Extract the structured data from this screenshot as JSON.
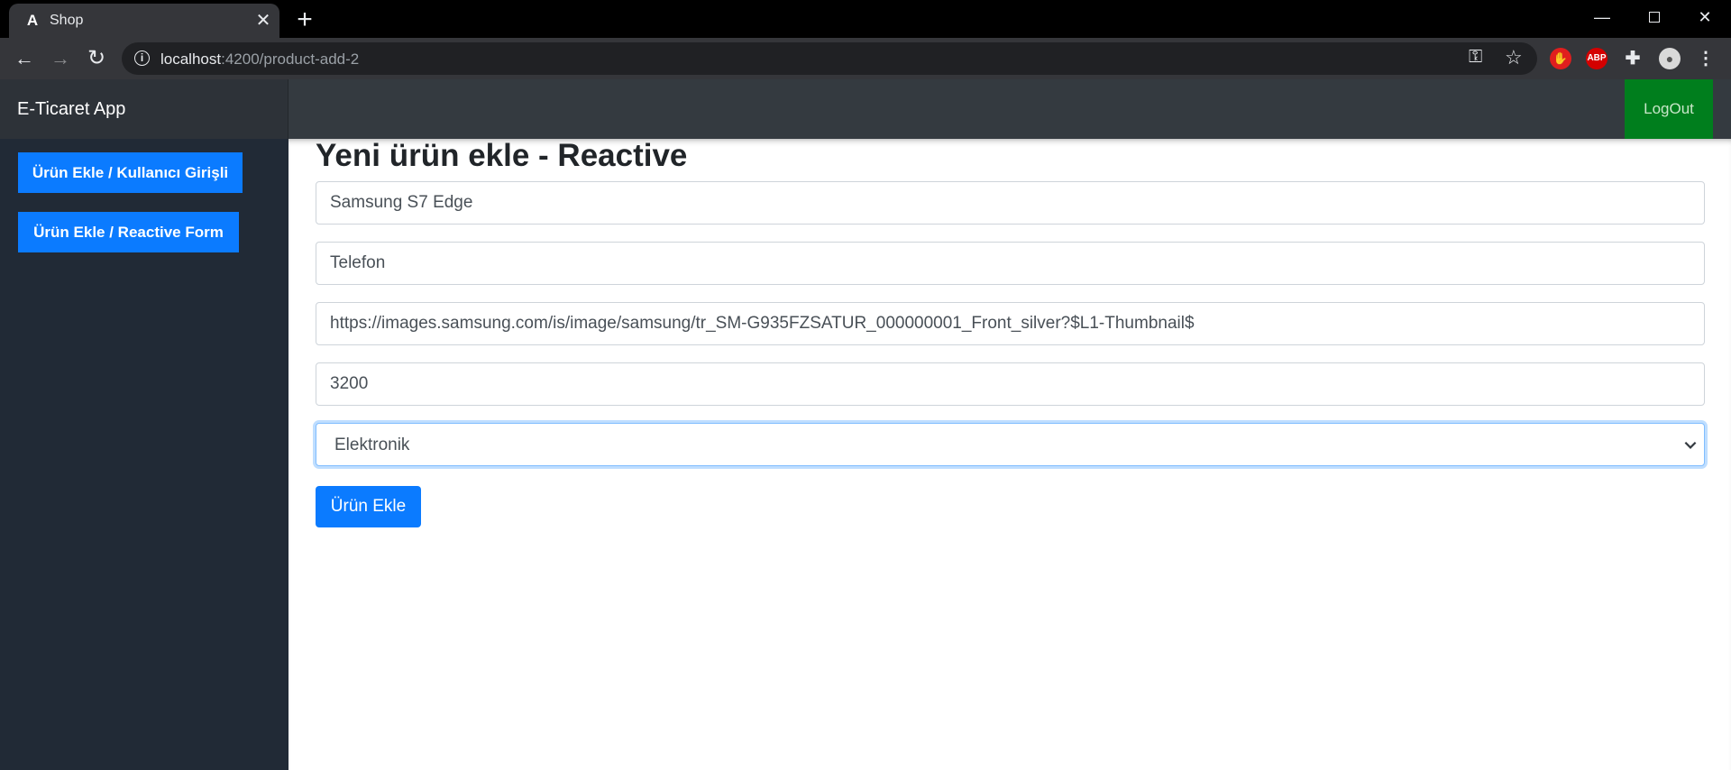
{
  "browser": {
    "tab_title": "Shop",
    "favicon_glyph": "A",
    "url_host": "localhost",
    "url_path": ":4200/product-add-2",
    "extensions": {
      "abp_label": "ABP"
    }
  },
  "app": {
    "brand": "E-Ticaret App",
    "logout_label": "LogOut",
    "colors": {
      "header": "#343a40",
      "sidebar": "#212a36",
      "primary": "#0b7bff",
      "logout": "#007e1d"
    }
  },
  "sidebar": {
    "items": [
      {
        "label": "Ürün Ekle / Kullanıcı Girişli"
      },
      {
        "label": "Ürün Ekle / Reactive Form"
      }
    ]
  },
  "form": {
    "title": "Yeni ürün ekle - Reactive",
    "name_value": "Samsung S7 Edge",
    "description_value": "Telefon",
    "image_url_value": "https://images.samsung.com/is/image/samsung/tr_SM-G935FZSATUR_000000001_Front_silver?$L1-Thumbnail$",
    "price_value": "3200",
    "category_selected": "Elektronik",
    "submit_label": "Ürün Ekle"
  }
}
